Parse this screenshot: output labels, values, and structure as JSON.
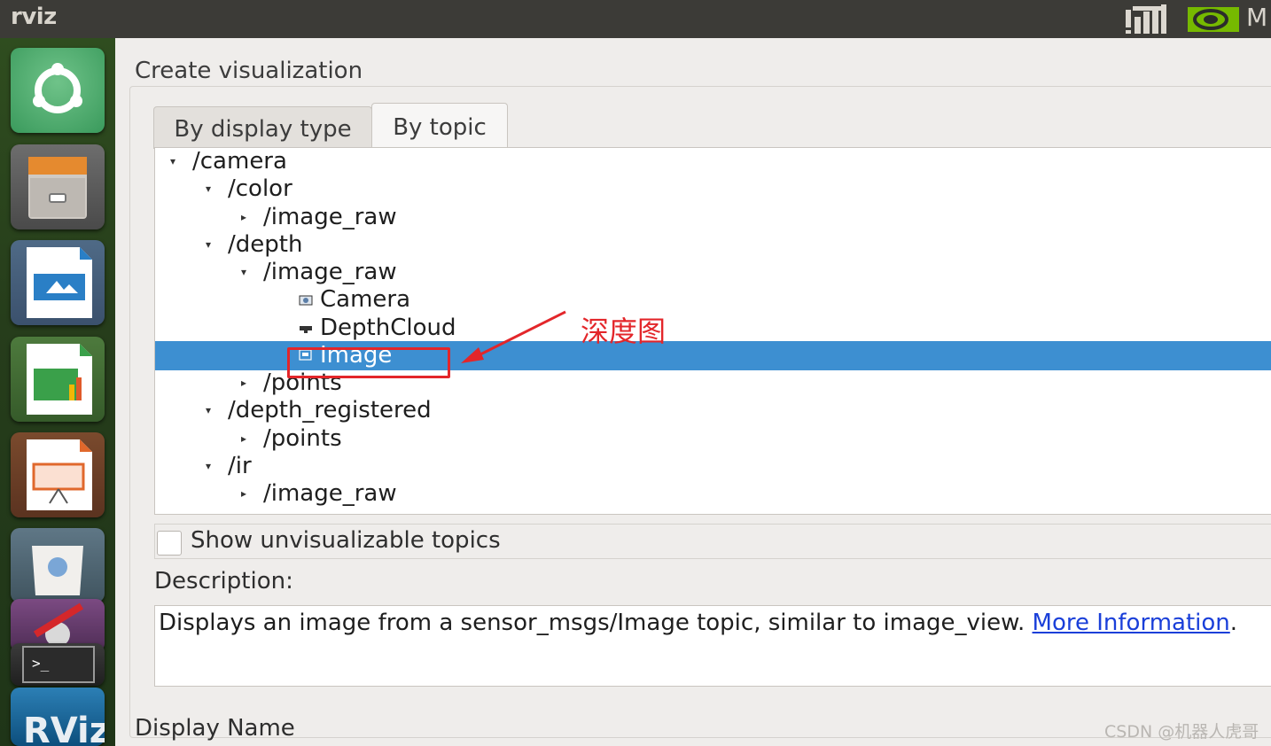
{
  "topbar": {
    "app_title": "rviz",
    "tray_more": "M"
  },
  "dialog": {
    "title": "Create visualization",
    "tabs": [
      {
        "label": "By display type",
        "selected": false
      },
      {
        "label": "By topic",
        "selected": true
      }
    ],
    "tree": [
      {
        "label": "/camera",
        "level": 0,
        "expander": "open"
      },
      {
        "label": "/color",
        "level": 1,
        "expander": "open"
      },
      {
        "label": "/image_raw",
        "level": 2,
        "expander": "closed"
      },
      {
        "label": "/depth",
        "level": 1,
        "expander": "open"
      },
      {
        "label": "/image_raw",
        "level": 2,
        "expander": "open"
      },
      {
        "label": "Camera",
        "level": 3,
        "icon": "camera-display-icon"
      },
      {
        "label": "DepthCloud",
        "level": 3,
        "icon": "depthcloud-display-icon"
      },
      {
        "label": "Image",
        "level": 3,
        "icon": "image-display-icon",
        "selected": true
      },
      {
        "label": "/points",
        "level": 2,
        "expander": "closed"
      },
      {
        "label": "/depth_registered",
        "level": 1,
        "expander": "open"
      },
      {
        "label": "/points",
        "level": 2,
        "expander": "closed"
      },
      {
        "label": "/ir",
        "level": 1,
        "expander": "open"
      },
      {
        "label": "/image_raw",
        "level": 2,
        "expander": "closed"
      }
    ],
    "show_unvisualizable": {
      "label": "Show unvisualizable topics",
      "checked": false
    },
    "description": {
      "title": "Description:",
      "text": "Displays an image from a sensor_msgs/Image topic, similar to image_view. ",
      "link": "More Information",
      "suffix": "."
    },
    "display_name_label": "Display Name"
  },
  "annotation": {
    "label": "深度图",
    "color": "#e3262a"
  },
  "launcher_icons": [
    "ubuntu-logo-icon",
    "files-icon",
    "writer-icon",
    "calc-icon",
    "impress-icon",
    "software-center-icon",
    "system-settings-icon",
    "terminal-icon",
    "rviz-icon"
  ],
  "watermark": "CSDN @机器人虎哥",
  "colors": {
    "selection": "#3d8fd1",
    "link": "#1a3fd9",
    "annotation": "#e3262a"
  }
}
